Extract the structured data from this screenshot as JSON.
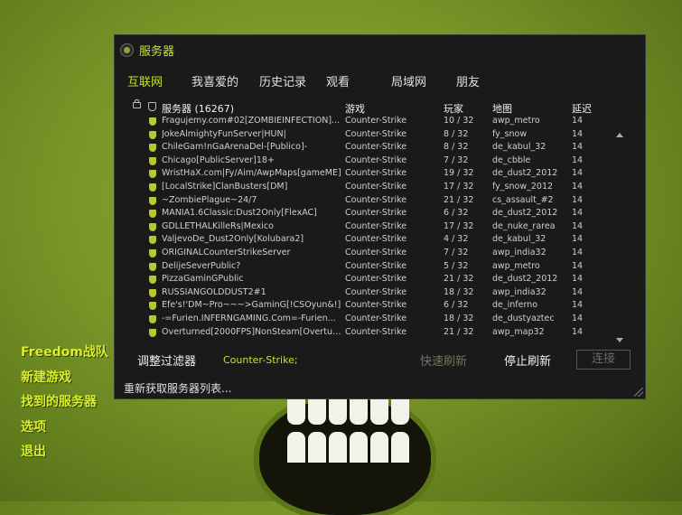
{
  "window": {
    "title": "服务器"
  },
  "tabs": [
    "互联网",
    "我喜爱的",
    "历史记录",
    "观看",
    "局域网",
    "朋友"
  ],
  "table": {
    "headers": {
      "name": "服务器 (16267)",
      "game": "游戏",
      "players": "玩家",
      "map": "地图",
      "latency": "延迟"
    },
    "rows": [
      {
        "name": "Fragujemy.com#02[ZOMBIEINFECTION]...",
        "game": "Counter-Strike",
        "players": "10 / 32",
        "map": "awp_metro",
        "latency": "14"
      },
      {
        "name": "JokeAlmightyFunServer|HUN|",
        "game": "Counter-Strike",
        "players": "8 / 32",
        "map": "fy_snow",
        "latency": "14"
      },
      {
        "name": "ChileGam!nGaArenaDel-[Publico]-",
        "game": "Counter-Strike",
        "players": "8 / 32",
        "map": "de_kabul_32",
        "latency": "14"
      },
      {
        "name": "Chicago[PublicServer]18+",
        "game": "Counter-Strike",
        "players": "7 / 32",
        "map": "de_cbble",
        "latency": "14"
      },
      {
        "name": "WristHaX.com|Fy/Aim/AwpMaps[gameME]",
        "game": "Counter-Strike",
        "players": "19 / 32",
        "map": "de_dust2_2012",
        "latency": "14"
      },
      {
        "name": "[LocalStrike]ClanBusters[DM]",
        "game": "Counter-Strike",
        "players": "17 / 32",
        "map": "fy_snow_2012",
        "latency": "14"
      },
      {
        "name": "~ZombiePlague~24/7",
        "game": "Counter-Strike",
        "players": "21 / 32",
        "map": "cs_assault_#2",
        "latency": "14"
      },
      {
        "name": "MANIA1.6Classic:Dust2Only[FlexAC]",
        "game": "Counter-Strike",
        "players": "6 / 32",
        "map": "de_dust2_2012",
        "latency": "14"
      },
      {
        "name": "GDLLETHALKilleRs|Mexico",
        "game": "Counter-Strike",
        "players": "17 / 32",
        "map": "de_nuke_rarea",
        "latency": "14"
      },
      {
        "name": "ValjevoDe_Dust2Only[Kolubara2]",
        "game": "Counter-Strike",
        "players": "4 / 32",
        "map": "de_kabul_32",
        "latency": "14"
      },
      {
        "name": "ORIGINALCounterStrikeServer",
        "game": "Counter-Strike",
        "players": "7 / 32",
        "map": "awp_india32",
        "latency": "14"
      },
      {
        "name": "DelijeSeverPublic?",
        "game": "Counter-Strike",
        "players": "5 / 32",
        "map": "awp_metro",
        "latency": "14"
      },
      {
        "name": "PizzaGaminGPublic",
        "game": "Counter-Strike",
        "players": "21 / 32",
        "map": "de_dust2_2012",
        "latency": "14"
      },
      {
        "name": "RUSSIANGOLDDUST2#1",
        "game": "Counter-Strike",
        "players": "18 / 32",
        "map": "awp_india32",
        "latency": "14"
      },
      {
        "name": "Efe's!'DM~Pro~~~>GaminG[!CSOyun&!]",
        "game": "Counter-Strike",
        "players": "6 / 32",
        "map": "de_inferno",
        "latency": "14"
      },
      {
        "name": "-=Furien.INFERNGAMING.Com=-Furien...",
        "game": "Counter-Strike",
        "players": "18 / 32",
        "map": "de_dustyaztec",
        "latency": "14"
      },
      {
        "name": "Overturned[2000FPS]NonSteam[Overtur...",
        "game": "Counter-Strike",
        "players": "21 / 32",
        "map": "awp_map32",
        "latency": "14"
      }
    ]
  },
  "bottom": {
    "filter_label": "调整过滤器",
    "filter_value": "Counter-Strike;",
    "quick_refresh": "快速刷新",
    "stop_refresh": "停止刷新",
    "connect": "连接",
    "status": "重新获取服务器列表..."
  },
  "menu": [
    "Freedom战队",
    "新建游戏",
    "找到的服务器",
    "选项",
    "退出"
  ],
  "colors": {
    "accent": "#c8e030",
    "window_bg": "#1a1a1a",
    "menu_text": "#d9ef2a",
    "background": "#7a9628"
  }
}
